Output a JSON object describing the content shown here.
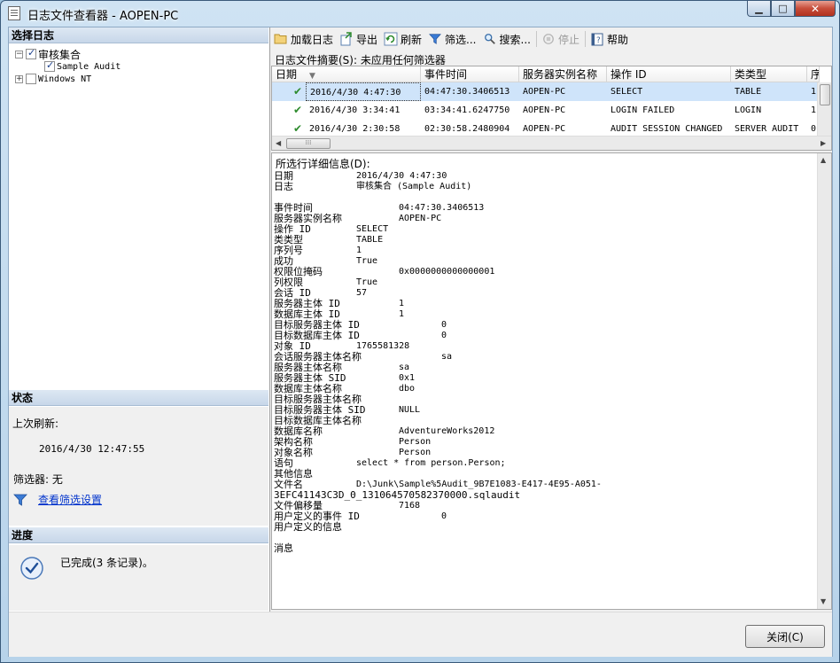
{
  "window": {
    "title": "日志文件查看器 - AOPEN-PC"
  },
  "left": {
    "select_log_header": "选择日志",
    "tree": [
      {
        "label": "审核集合",
        "checked": true,
        "expander": "−"
      },
      {
        "label": "Sample Audit",
        "checked": true
      },
      {
        "label": "Windows NT",
        "checked": false,
        "expander": "+"
      }
    ],
    "status_header": "状态",
    "last_refresh_label": "上次刷新:",
    "last_refresh_value": "2016/4/30 12:47:55",
    "filter_label": "筛选器: 无",
    "view_filter_link": "查看筛选设置",
    "progress_header": "进度",
    "progress_text": "已完成(3 条记录)。"
  },
  "toolbar": {
    "load": "加载日志",
    "export": "导出",
    "refresh": "刷新",
    "filter": "筛选...",
    "search": "搜索...",
    "stop": "停止",
    "help": "帮助"
  },
  "summary": {
    "label": "日志文件摘要(S): 未应用任何筛选器"
  },
  "grid": {
    "columns": [
      "日期",
      "事件时间",
      "服务器实例名称",
      "操作 ID",
      "类类型",
      "序"
    ],
    "rows": [
      {
        "date": "2016/4/30 4:47:30",
        "event_time": "04:47:30.3406513",
        "server": "AOPEN-PC",
        "action": "SELECT",
        "class": "TABLE",
        "seq": "1"
      },
      {
        "date": "2016/4/30 3:34:41",
        "event_time": "03:34:41.6247750",
        "server": "AOPEN-PC",
        "action": "LOGIN FAILED",
        "class": "LOGIN",
        "seq": "1"
      },
      {
        "date": "2016/4/30 2:30:58",
        "event_time": "02:30:58.2480904",
        "server": "AOPEN-PC",
        "action": "AUDIT SESSION CHANGED",
        "class": "SERVER AUDIT",
        "seq": "0"
      }
    ]
  },
  "details": {
    "title": "所选行详细信息(D):",
    "lines": [
      {
        "label": "日期",
        "value": "2016/4/30 4:47:30",
        "indent": 1
      },
      {
        "label": "日志",
        "value": "审核集合 (Sample Audit)",
        "indent": 1
      },
      {
        "label": "",
        "value": "",
        "indent": 0
      },
      {
        "label": "事件时间",
        "value": "04:47:30.3406513",
        "indent": 2
      },
      {
        "label": "服务器实例名称",
        "value": "AOPEN-PC",
        "indent": 2
      },
      {
        "label": "操作 ID",
        "value": "SELECT",
        "indent": 1
      },
      {
        "label": "类类型",
        "value": "TABLE",
        "indent": 1
      },
      {
        "label": "序列号",
        "value": "1",
        "indent": 1
      },
      {
        "label": "成功",
        "value": "True",
        "indent": 1
      },
      {
        "label": "权限位掩码",
        "value": "0x0000000000000001",
        "indent": 2
      },
      {
        "label": "列权限",
        "value": "True",
        "indent": 1
      },
      {
        "label": "会话 ID",
        "value": "57",
        "indent": 1
      },
      {
        "label": "服务器主体 ID",
        "value": "1",
        "indent": 2
      },
      {
        "label": "数据库主体 ID",
        "value": "1",
        "indent": 2
      },
      {
        "label": "目标服务器主体 ID",
        "value": "0",
        "indent": 3
      },
      {
        "label": "目标数据库主体 ID",
        "value": "0",
        "indent": 3
      },
      {
        "label": "对象 ID",
        "value": "1765581328",
        "indent": 1
      },
      {
        "label": "会话服务器主体名称",
        "value": "sa",
        "indent": 3
      },
      {
        "label": "服务器主体名称",
        "value": "sa",
        "indent": 2
      },
      {
        "label": "服务器主体 SID",
        "value": "0x1",
        "indent": 2
      },
      {
        "label": "数据库主体名称",
        "value": "dbo",
        "indent": 2
      },
      {
        "label": "目标服务器主体名称",
        "value": "",
        "indent": 0
      },
      {
        "label": "目标服务器主体 SID",
        "value": "NULL",
        "indent": 2
      },
      {
        "label": "目标数据库主体名称",
        "value": "",
        "indent": 0
      },
      {
        "label": "数据库名称",
        "value": "AdventureWorks2012",
        "indent": 2
      },
      {
        "label": "架构名称",
        "value": "Person",
        "indent": 2
      },
      {
        "label": "对象名称",
        "value": "Person",
        "indent": 2
      },
      {
        "label": "语句",
        "value": "select * from person.Person;",
        "indent": 1
      },
      {
        "label": "其他信息",
        "value": "",
        "indent": 0
      },
      {
        "label": "文件名",
        "value": "D:\\Junk\\Sample%5Audit_9B7E1083-E417-4E95-A051-",
        "indent": 1
      },
      {
        "label": "3EFC41143C3D_0_131064570582370000.sqlaudit",
        "value": "",
        "indent": 0
      },
      {
        "label": "文件偏移量",
        "value": "7168",
        "indent": 2
      },
      {
        "label": "用户定义的事件 ID",
        "value": "0",
        "indent": 3
      },
      {
        "label": "用户定义的信息",
        "value": "",
        "indent": 0
      },
      {
        "label": "",
        "value": "",
        "indent": 0
      },
      {
        "label": "消息",
        "value": "",
        "indent": 0
      }
    ]
  },
  "buttons": {
    "close": "关闭(C)"
  },
  "colors": {
    "selected_row": "#cfe4fa",
    "link": "#0033cc",
    "check_green": "#2e8b2e"
  }
}
